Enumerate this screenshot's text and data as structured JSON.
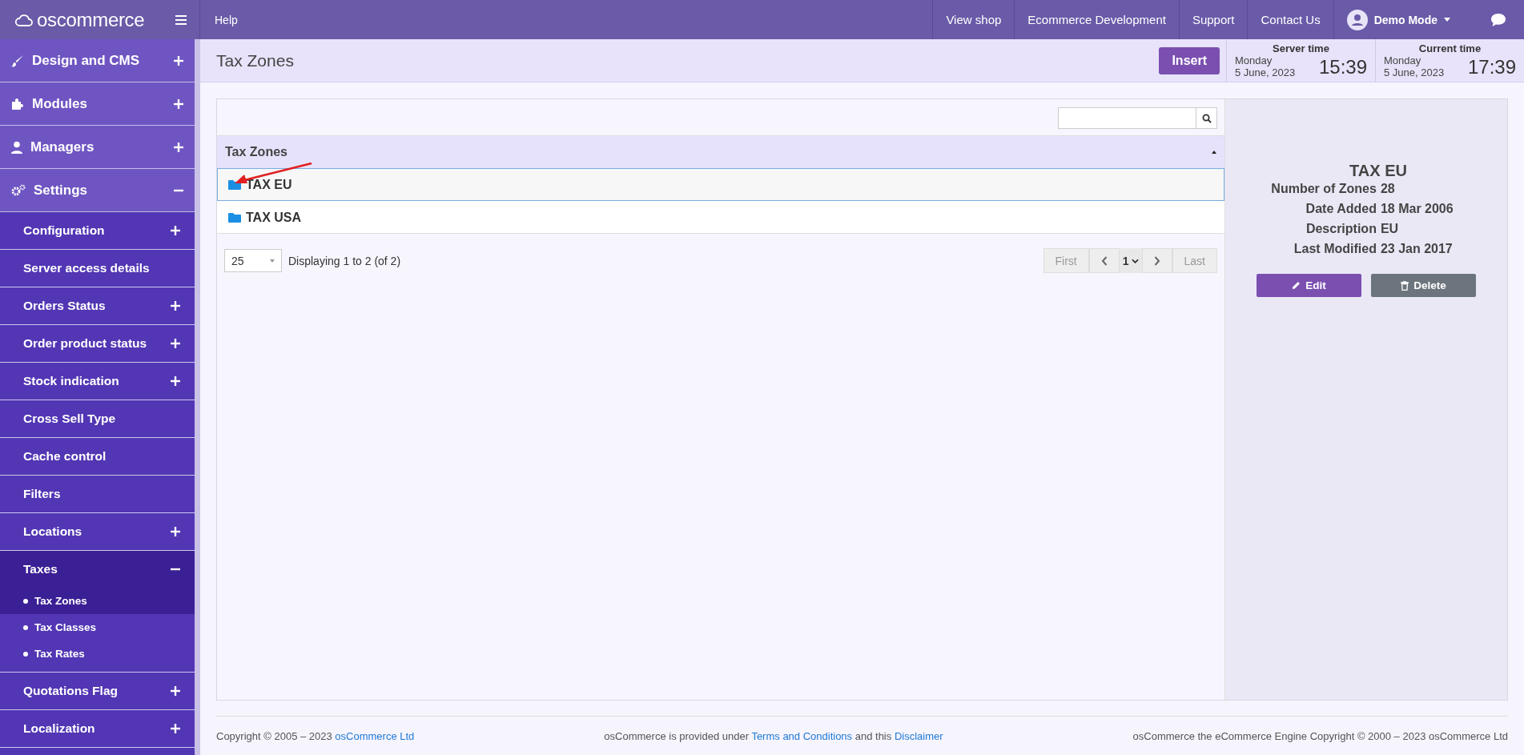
{
  "top_bar": {
    "logo": "oscommerce",
    "help": "Help",
    "links": [
      "View shop",
      "Ecommerce Development",
      "Support",
      "Contact Us"
    ],
    "user": "Demo Mode"
  },
  "sidebar": {
    "items": [
      {
        "label": "Design and CMS",
        "expanded": false
      },
      {
        "label": "Modules",
        "expanded": false
      },
      {
        "label": "Managers",
        "expanded": false
      },
      {
        "label": "Settings",
        "expanded": true,
        "children": [
          {
            "label": "Configuration",
            "expanded": false
          },
          {
            "label": "Server access details"
          },
          {
            "label": "Orders Status",
            "expanded": false
          },
          {
            "label": "Order product status",
            "expanded": false
          },
          {
            "label": "Stock indication",
            "expanded": false
          },
          {
            "label": "Cross Sell Type"
          },
          {
            "label": "Cache control"
          },
          {
            "label": "Filters"
          },
          {
            "label": "Locations",
            "expanded": false
          },
          {
            "label": "Taxes",
            "expanded": true,
            "children": [
              {
                "label": "Tax Zones",
                "selected": true
              },
              {
                "label": "Tax Classes",
                "selected": false
              },
              {
                "label": "Tax Rates",
                "selected": false
              }
            ]
          },
          {
            "label": "Quotations Flag",
            "expanded": false
          },
          {
            "label": "Localization",
            "expanded": false
          }
        ]
      }
    ]
  },
  "header": {
    "title": "Tax Zones",
    "insert": "Insert",
    "clocks": [
      {
        "label": "Server time",
        "day": "Monday",
        "date": "5 June, 2023",
        "time": "15:39"
      },
      {
        "label": "Current time",
        "day": "Monday",
        "date": "5 June, 2023",
        "time": "17:39"
      }
    ]
  },
  "table": {
    "column": "Tax Zones",
    "rows": [
      {
        "name": "TAX EU",
        "selected": true
      },
      {
        "name": "TAX USA",
        "selected": false
      }
    ],
    "per_page": "25",
    "summary": "Displaying 1 to 2 (of 2)",
    "pagination": {
      "first": {
        "label": "First",
        "disabled": true
      },
      "page": "1",
      "last": {
        "label": "Last",
        "disabled": true
      }
    }
  },
  "details": {
    "title": "TAX EU",
    "fields": [
      {
        "label": "Number of Zones",
        "value": "28"
      },
      {
        "label": "Date Added",
        "value": "18 Mar 2006"
      },
      {
        "label": "Description",
        "value": "EU"
      },
      {
        "label": "Last Modified",
        "value": "23 Jan 2017"
      }
    ],
    "buttons": [
      {
        "kind": "edit",
        "label": "Edit"
      },
      {
        "kind": "delete",
        "label": "Delete"
      }
    ]
  },
  "footer": {
    "copyright": "Copyright © 2005 – 2023",
    "company_link": "osCommerce Ltd",
    "notice_1": "osCommerce is provided under",
    "terms_link": "Terms and Conditions",
    "notice_2": "and this",
    "disclaimer_link": "Disclaimer",
    "engine": "osCommerce the eCommerce Engine Copyright © 2000 – 2023 osCommerce Ltd"
  }
}
